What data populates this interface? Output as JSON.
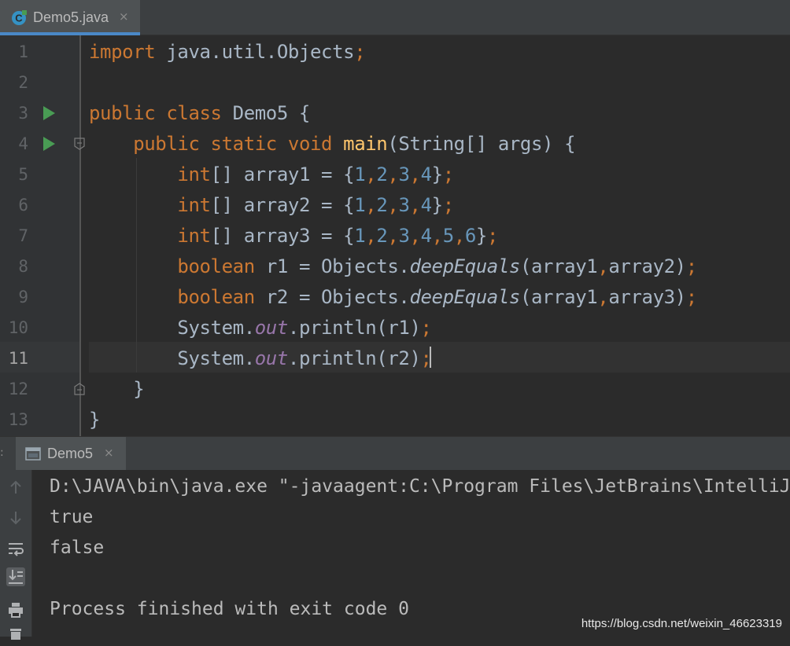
{
  "editor_tab": {
    "label": "Demo5.java",
    "close": "×",
    "icon": "java-class-icon"
  },
  "code": {
    "lines": [
      {
        "num": "1",
        "text": "import java.util.Objects;"
      },
      {
        "num": "2",
        "text": ""
      },
      {
        "num": "3",
        "text": "public class Demo5 {"
      },
      {
        "num": "4",
        "text": "    public static void main(String[] args) {"
      },
      {
        "num": "5",
        "text": "        int[] array1 = {1,2,3,4};"
      },
      {
        "num": "6",
        "text": "        int[] array2 = {1,2,3,4};"
      },
      {
        "num": "7",
        "text": "        int[] array3 = {1,2,3,4,5,6};"
      },
      {
        "num": "8",
        "text": "        boolean r1 = Objects.deepEquals(array1,array2);"
      },
      {
        "num": "9",
        "text": "        boolean r2 = Objects.deepEquals(array1,array3);"
      },
      {
        "num": "10",
        "text": "        System.out.println(r1);"
      },
      {
        "num": "11",
        "text": "        System.out.println(r2);"
      },
      {
        "num": "12",
        "text": "    }"
      },
      {
        "num": "13",
        "text": "}"
      }
    ],
    "current_line": "11",
    "run_gutter_lines": [
      "3",
      "4"
    ]
  },
  "colors": {
    "keyword": "#cc7832",
    "number": "#6897bb",
    "method_decl": "#ffc66d",
    "static_field": "#9876aa",
    "plain": "#a9b7c6",
    "run_icon": "#499c54",
    "tab_underline": "#4a88c7"
  },
  "run_panel": {
    "tab_label": "Demo5",
    "close": "×",
    "output": [
      "D:\\JAVA\\bin\\java.exe \"-javaagent:C:\\Program Files\\JetBrains\\IntelliJ",
      "true",
      "false",
      "",
      "Process finished with exit code 0"
    ],
    "toolbar_icons": [
      "up-arrow-icon",
      "down-arrow-icon",
      "soft-wrap-icon",
      "scroll-to-end-icon",
      "print-icon",
      "trash-icon"
    ]
  },
  "watermark": "https://blog.csdn.net/weixin_46623319"
}
